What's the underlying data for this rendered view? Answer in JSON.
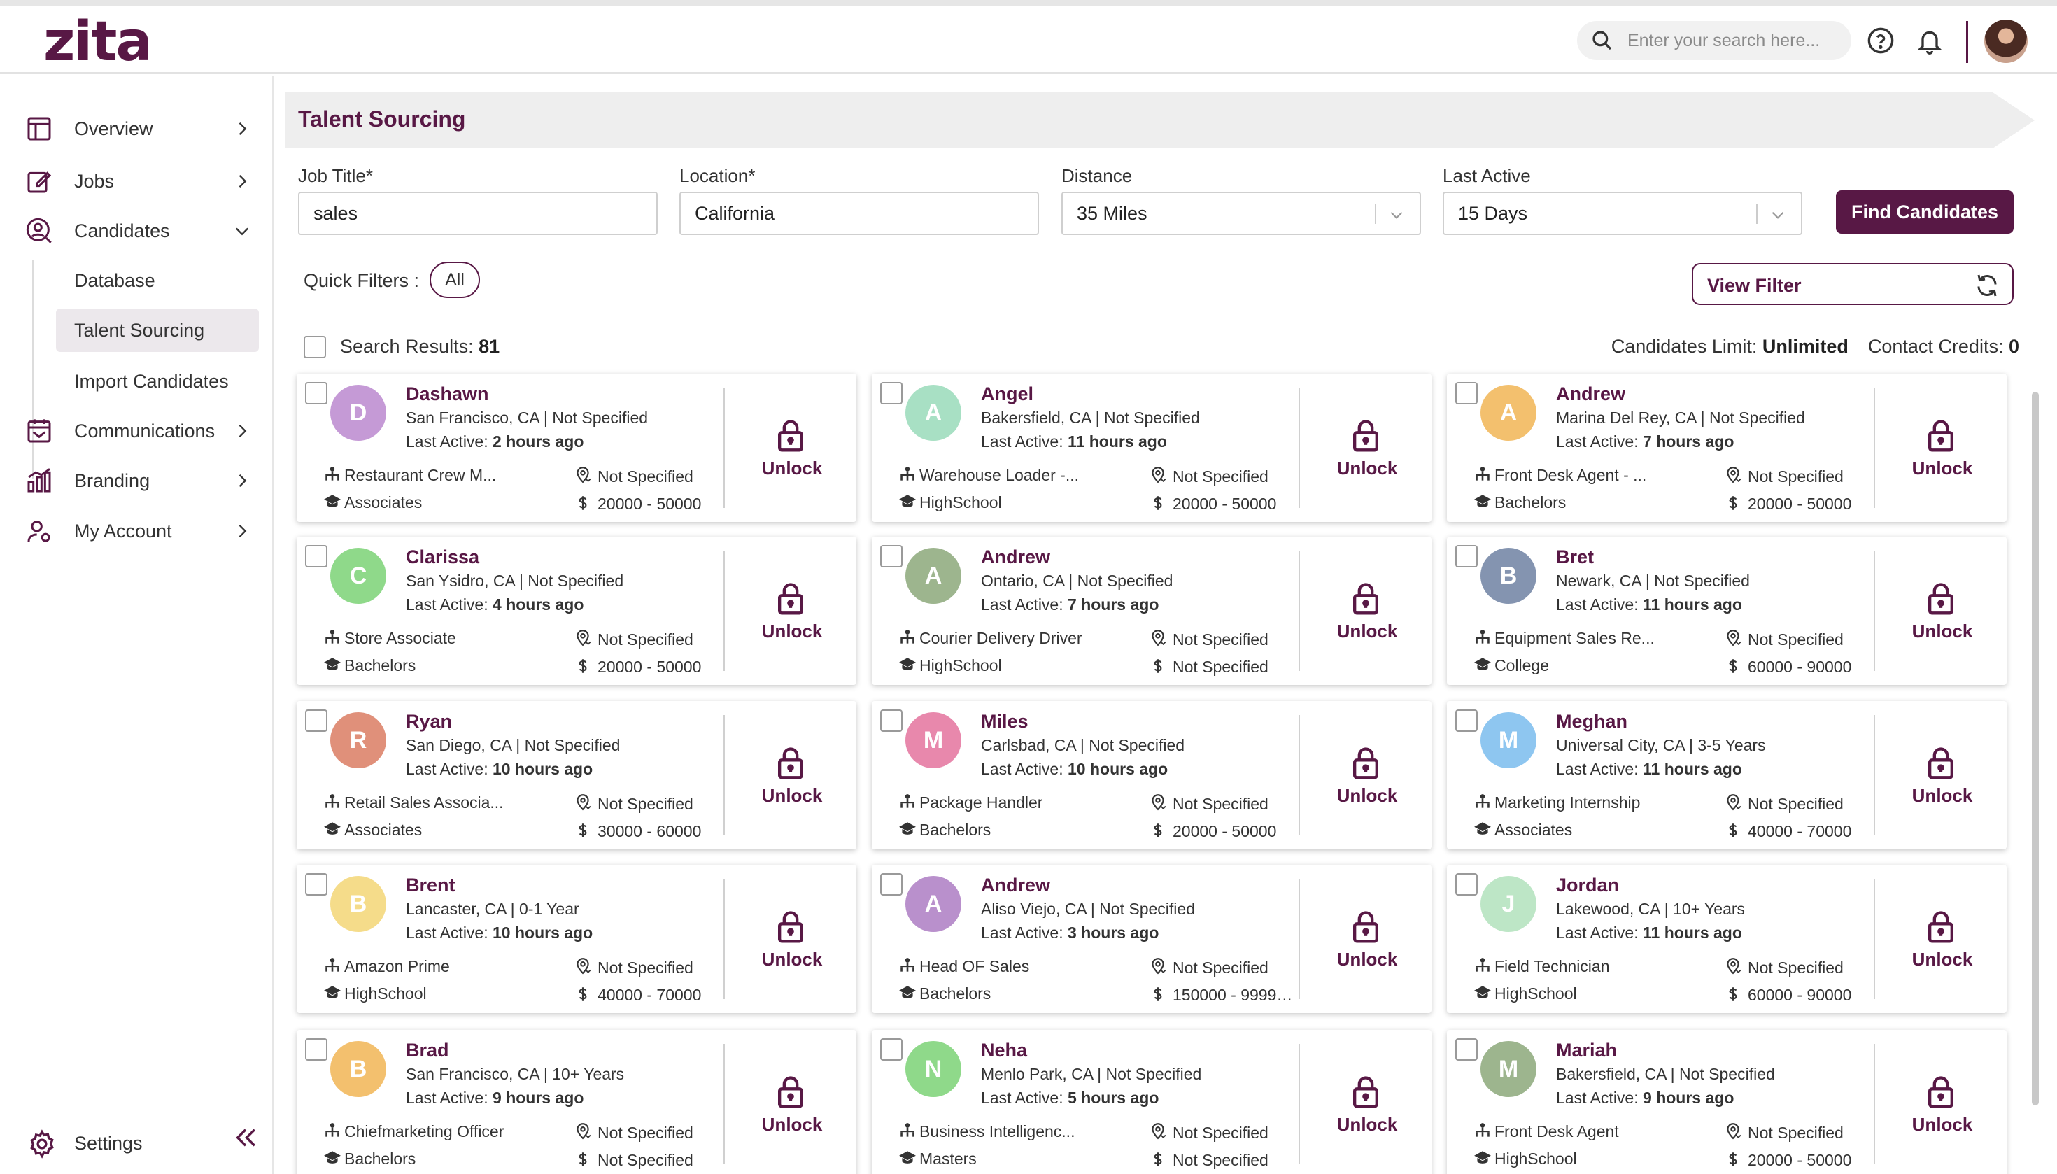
{
  "app": {
    "logo": "zita",
    "search_placeholder": "Enter your search here...",
    "colors": {
      "brand": "#581845",
      "active_nav_bg": "#ece8ec"
    }
  },
  "sidebar": {
    "items": [
      {
        "label": "Overview",
        "icon": "layout-icon"
      },
      {
        "label": "Jobs",
        "icon": "edit-icon"
      },
      {
        "label": "Candidates",
        "icon": "user-search-icon"
      },
      {
        "label": "Communications",
        "icon": "calendar-mail-icon"
      },
      {
        "label": "Branding",
        "icon": "chart-icon"
      },
      {
        "label": "My Account",
        "icon": "user-gear-icon"
      }
    ],
    "candidates_sub": [
      "Database",
      "Talent Sourcing",
      "Import Candidates"
    ],
    "settings_label": "Settings"
  },
  "main": {
    "title": "Talent Sourcing",
    "fields": {
      "job_title_label": "Job Title",
      "job_title_value": "sales",
      "location_label": "Location",
      "location_value": "California",
      "distance_label": "Distance",
      "distance_value": "35 Miles",
      "last_active_label": "Last Active",
      "last_active_value": "15 Days",
      "required_mark": "*"
    },
    "find_button": "Find Candidates",
    "quick_filters_label": "Quick Filters :",
    "quick_filter_chip": "All",
    "view_filter_label": "View Filter",
    "results_label": "Search Results:",
    "results_count": "81",
    "limit_label": "Candidates Limit:",
    "limit_value": "Unlimited",
    "credits_label": "Contact Credits:",
    "credits_value": "0",
    "last_active_prefix": "Last Active:",
    "unlock_label": "Unlock"
  },
  "candidates": [
    {
      "initial": "D",
      "color": "#c59ad6",
      "name": "Dashawn",
      "location": "San Francisco, CA | Not Specified",
      "last_active": "2 hours ago",
      "role": "Restaurant Crew M...",
      "education": "Associates",
      "relocate": "Not Specified",
      "salary": "20000 - 50000"
    },
    {
      "initial": "A",
      "color": "#a8e0c4",
      "name": "Angel",
      "location": "Bakersfield, CA | Not Specified",
      "last_active": "11 hours ago",
      "role": "Warehouse Loader -...",
      "education": "HighSchool",
      "relocate": "Not Specified",
      "salary": "20000 - 50000"
    },
    {
      "initial": "A",
      "color": "#f3c06e",
      "name": "Andrew",
      "location": "Marina Del Rey, CA | Not Specified",
      "last_active": "7 hours ago",
      "role": "Front Desk Agent - ...",
      "education": "Bachelors",
      "relocate": "Not Specified",
      "salary": "20000 - 50000"
    },
    {
      "initial": "C",
      "color": "#8fd98a",
      "name": "Clarissa",
      "location": "San Ysidro, CA | Not Specified",
      "last_active": "4 hours ago",
      "role": "Store Associate",
      "education": "Bachelors",
      "relocate": "Not Specified",
      "salary": "20000 - 50000"
    },
    {
      "initial": "A",
      "color": "#9db58e",
      "name": "Andrew",
      "location": "Ontario, CA | Not Specified",
      "last_active": "7 hours ago",
      "role": "Courier Delivery Driver",
      "education": "HighSchool",
      "relocate": "Not Specified",
      "salary": "Not Specified"
    },
    {
      "initial": "B",
      "color": "#8494b0",
      "name": "Bret",
      "location": "Newark, CA | Not Specified",
      "last_active": "11 hours ago",
      "role": "Equipment Sales Re...",
      "education": "College",
      "relocate": "Not Specified",
      "salary": "60000 - 90000"
    },
    {
      "initial": "R",
      "color": "#e0907a",
      "name": "Ryan",
      "location": "San Diego, CA | Not Specified",
      "last_active": "10 hours ago",
      "role": "Retail Sales Associa...",
      "education": "Associates",
      "relocate": "Not Specified",
      "salary": "30000 - 60000"
    },
    {
      "initial": "M",
      "color": "#e888ac",
      "name": "Miles",
      "location": "Carlsbad, CA | Not Specified",
      "last_active": "10 hours ago",
      "role": "Package Handler",
      "education": "Bachelors",
      "relocate": "Not Specified",
      "salary": "20000 - 50000"
    },
    {
      "initial": "M",
      "color": "#8ec6f0",
      "name": "Meghan",
      "location": "Universal City, CA | 3-5 Years",
      "last_active": "11 hours ago",
      "role": "Marketing Internship",
      "education": "Associates",
      "relocate": "Not Specified",
      "salary": "40000 - 70000"
    },
    {
      "initial": "B",
      "color": "#f5dc8a",
      "name": "Brent",
      "location": "Lancaster, CA | 0-1 Year",
      "last_active": "10 hours ago",
      "role": "Amazon Prime",
      "education": "HighSchool",
      "relocate": "Not Specified",
      "salary": "40000 - 70000"
    },
    {
      "initial": "A",
      "color": "#b990cc",
      "name": "Andrew",
      "location": "Aliso Viejo, CA | Not Specified",
      "last_active": "3 hours ago",
      "role": "Head OF Sales",
      "education": "Bachelors",
      "relocate": "Not Specified",
      "salary": "150000 - 999999..."
    },
    {
      "initial": "J",
      "color": "#bde6c6",
      "name": "Jordan",
      "location": "Lakewood, CA | 10+ Years",
      "last_active": "11 hours ago",
      "role": "Field Technician",
      "education": "HighSchool",
      "relocate": "Not Specified",
      "salary": "60000 - 90000"
    },
    {
      "initial": "B",
      "color": "#f3c06e",
      "name": "Brad",
      "location": "San Francisco, CA | 10+ Years",
      "last_active": "9 hours ago",
      "role": "Chiefmarketing Officer",
      "education": "Bachelors",
      "relocate": "Not Specified",
      "salary": "Not Specified"
    },
    {
      "initial": "N",
      "color": "#8fd98a",
      "name": "Neha",
      "location": "Menlo Park, CA | Not Specified",
      "last_active": "5 hours ago",
      "role": "Business Intelligenc...",
      "education": "Masters",
      "relocate": "Not Specified",
      "salary": "Not Specified"
    },
    {
      "initial": "M",
      "color": "#9db58e",
      "name": "Mariah",
      "location": "Bakersfield, CA | Not Specified",
      "last_active": "9 hours ago",
      "role": "Front Desk Agent",
      "education": "HighSchool",
      "relocate": "Not Specified",
      "salary": "20000 - 50000"
    }
  ]
}
